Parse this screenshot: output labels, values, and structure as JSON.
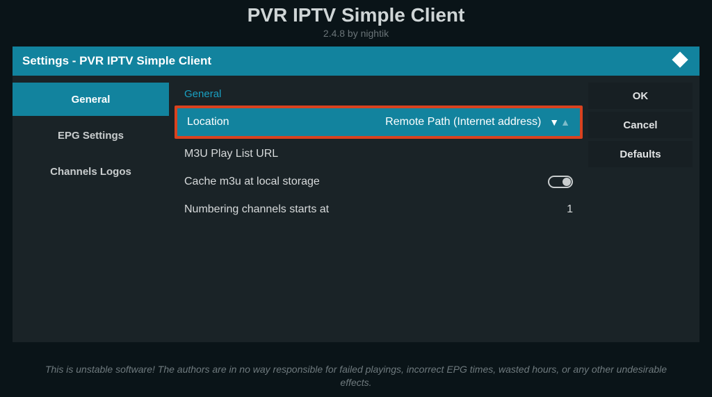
{
  "page": {
    "title": "PVR IPTV Simple Client",
    "version_line": "2.4.8 by nightik"
  },
  "dialog": {
    "title": "Settings - PVR IPTV Simple Client"
  },
  "sidebar": {
    "items": [
      {
        "label": "General"
      },
      {
        "label": "EPG Settings"
      },
      {
        "label": "Channels Logos"
      }
    ]
  },
  "section_header": "General",
  "settings": {
    "location": {
      "label": "Location",
      "value": "Remote Path (Internet address)"
    },
    "m3u_url": {
      "label": "M3U Play List URL",
      "value": ""
    },
    "cache": {
      "label": "Cache m3u at local storage",
      "value": "on"
    },
    "numbering": {
      "label": "Numbering channels starts at",
      "value": "1"
    }
  },
  "actions": {
    "ok": "OK",
    "cancel": "Cancel",
    "defaults": "Defaults"
  },
  "disclaimer": "This is unstable software! The authors are in no way responsible for failed playings, incorrect EPG times, wasted hours, or any other undesirable effects."
}
